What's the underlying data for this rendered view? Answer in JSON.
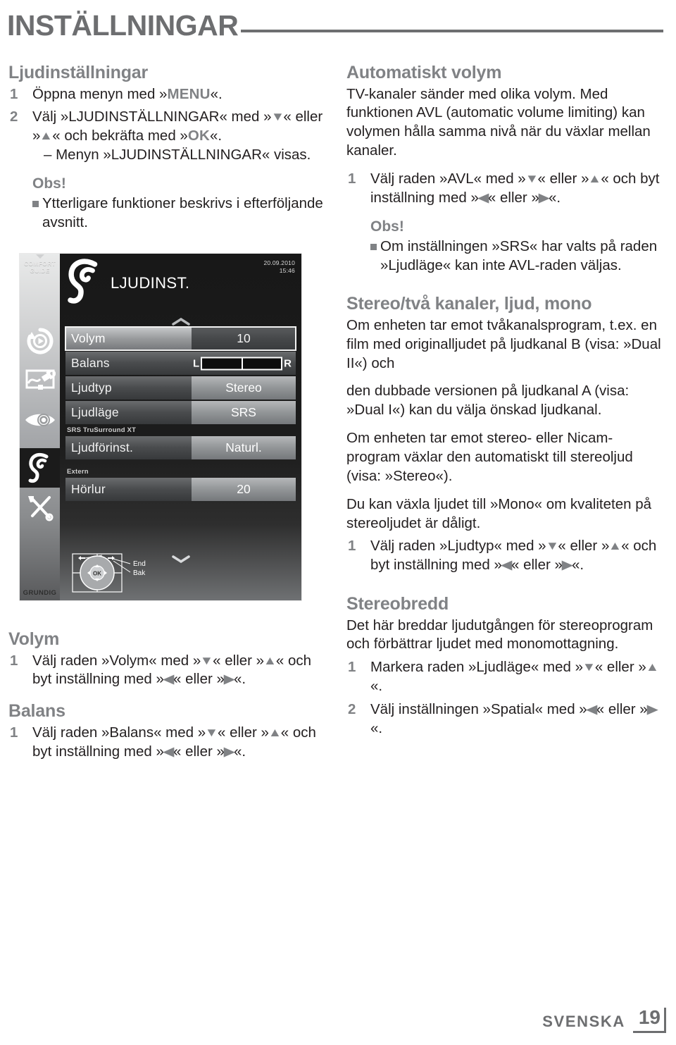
{
  "header": {
    "title": "INSTÄLLNINGAR"
  },
  "left_column": {
    "section1": {
      "heading": "Ljudinställningar",
      "items": [
        {
          "num": "1",
          "text_1": "Öppna menyn med »",
          "kb_1": "MENU",
          "text_2": "«."
        },
        {
          "num": "2",
          "text_1": "Välj »LJUDINSTÄLLNINGAR« med »",
          "arrow_1": "down",
          "text_2": "« eller »",
          "arrow_2": "up",
          "text_3": "« och bekräfta med »",
          "kb_1": "OK",
          "text_4": "«."
        }
      ],
      "subitem": "– Menyn »LJUDINSTÄLLNINGAR« visas.",
      "obs_heading": "Obs!",
      "obs_bullet": "Ytterligare funktioner beskrivs i efterföljande avsnitt."
    },
    "section_volym": {
      "heading": "Volym",
      "item": {
        "num": "1",
        "text_1": "Välj raden »Volym« med »",
        "arrow_1": "down",
        "text_2": "« eller »",
        "arrow_2": "up",
        "text_3": "« och byt inställning med »",
        "arrow_3": "left",
        "text_4": "« eller »",
        "arrow_4": "right",
        "text_5": "«."
      }
    },
    "section_balans": {
      "heading": "Balans",
      "item": {
        "num": "1",
        "text_1": "Välj raden »Balans« med »",
        "arrow_1": "down",
        "text_2": "« eller »",
        "arrow_2": "up",
        "text_3": "« och byt inställning med »",
        "arrow_3": "left",
        "text_4": "« eller »",
        "arrow_4": "right",
        "text_5": "«."
      }
    }
  },
  "right_column": {
    "section_avl": {
      "heading": "Automatiskt volym",
      "paragraph": "TV-kanaler sänder med olika volym. Med funktionen AVL (automatic volume limiting) kan volymen hålla samma nivå när du växlar mellan kanaler.",
      "item": {
        "num": "1",
        "text_1": "Välj raden »AVL« med »",
        "arrow_1": "down",
        "text_2": "« eller »",
        "arrow_2": "up",
        "text_3": "« och byt inställning med »",
        "arrow_3": "left",
        "text_4": "« eller »",
        "arrow_4": "right",
        "text_5": "«."
      },
      "obs_heading": "Obs!",
      "obs_bullet": "Om inställningen »SRS« har valts på raden »Ljudläge« kan inte AVL-raden väljas."
    },
    "section_stereo": {
      "heading": "Stereo/två kanaler, ljud, mono",
      "paragraph_1": "Om enheten tar emot tvåkanalsprogram, t.ex. en film med originalljudet på ljudkanal B (visa: »Dual II«) och",
      "paragraph_2": "den dubbade versionen på ljudkanal A (visa: »Dual I«) kan du välja önskad ljudkanal.",
      "paragraph_3": "Om enheten tar emot stereo- eller Nicam-program växlar den automatiskt till stereoljud (visa: »Stereo«).",
      "paragraph_4": "Du kan växla ljudet till »Mono« om kvaliteten på stereoljudet är dåligt.",
      "item": {
        "num": "1",
        "text_1": "Välj raden »Ljudtyp« med »",
        "arrow_1": "down",
        "text_2": "« eller »",
        "arrow_2": "up",
        "text_3": "« och byt inställning med »",
        "arrow_3": "left",
        "text_4": "« eller »",
        "arrow_4": "right",
        "text_5": "«."
      }
    },
    "section_stereobredd": {
      "heading": "Stereobredd",
      "paragraph": "Det här breddar ljudutgången för stereoprogram och förbättrar ljudet med monomottagning.",
      "item1": {
        "num": "1",
        "text_1": "Markera raden »Ljudläge« med »",
        "arrow_1": "down",
        "text_2": "« eller »",
        "arrow_2": "up",
        "text_3": "«."
      },
      "item2": {
        "num": "2",
        "text_1": "Välj inställningen »Spatial« med »",
        "arrow_1": "left",
        "text_2": "« eller »",
        "arrow_2": "right",
        "text_3": "«."
      }
    }
  },
  "osd": {
    "sidebar": {
      "comfort_guide_line1": "COMFORT",
      "comfort_guide_line2": "GUIDE",
      "brand": "GRUNDIG",
      "icons": [
        {
          "name": "media-play-icon",
          "active": false
        },
        {
          "name": "picture-settings-icon",
          "active": false
        },
        {
          "name": "eye-icon",
          "active": false
        },
        {
          "name": "ear-sound-icon",
          "active": true
        },
        {
          "name": "tools-icon",
          "active": false
        }
      ]
    },
    "menu_title": "LJUDINST.",
    "date": "20.09.2010",
    "time": "15:46",
    "rows": [
      {
        "label": "Volym",
        "value": "10",
        "style": "selected"
      },
      {
        "label": "Balans",
        "value": "",
        "style": "balance"
      },
      {
        "label": "Ljudtyp",
        "value": "Stereo",
        "style": "light"
      },
      {
        "label": "Ljudläge",
        "value": "SRS",
        "style": "light"
      }
    ],
    "group1_label": "SRS TruSurround XT",
    "row_preset": {
      "label": "Ljudförinst.",
      "value": "Naturl.",
      "style": "light"
    },
    "group2_label": "Extern",
    "row_headphone": {
      "label": "Hörlur",
      "value": "20",
      "style": "light"
    },
    "balance": {
      "left_label": "L",
      "right_label": "R"
    },
    "remote": {
      "ok_label": "OK",
      "end_label": "End",
      "back_label": "Bak"
    }
  },
  "footer": {
    "language": "SVENSKA",
    "page_number": "19"
  },
  "colors": {
    "heading_gray": "#808285",
    "title_gray": "#6d6e70",
    "body_black": "#231f20",
    "osd_dark": "#1b1b1b"
  }
}
